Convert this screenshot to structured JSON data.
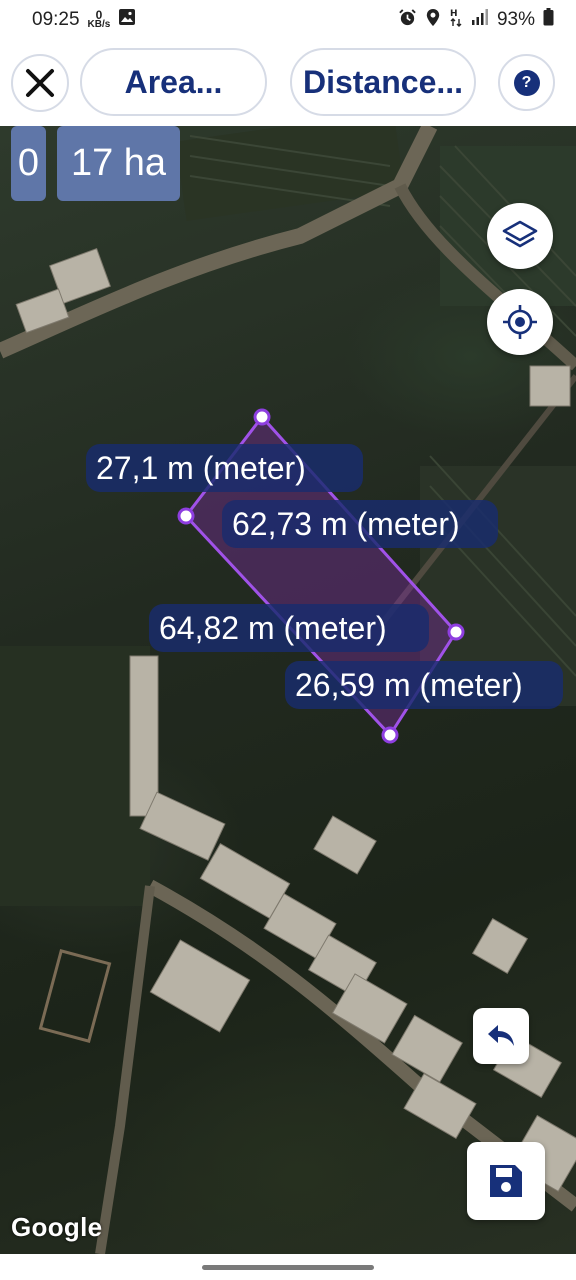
{
  "status_bar": {
    "time": "09:25",
    "net_speed_value": "0",
    "net_speed_unit": "KB/s",
    "battery": "93%",
    "icons": [
      "gallery-icon",
      "alarm-icon",
      "location-icon",
      "data-icon",
      "signal-icon",
      "battery-icon"
    ]
  },
  "toolbar": {
    "area_label": "Area...",
    "distance_label": "Distance...",
    "help_label": "?",
    "icons": {
      "close": "close-icon",
      "help": "help-icon"
    }
  },
  "map": {
    "chip_left": "0",
    "area_value": "17 ha",
    "labels": {
      "top_left": "27,1 m (meter)",
      "top_right": "62,73 m (meter)",
      "bottom_left": "64,82 m (meter)",
      "bottom_right": "26,59 m (meter)"
    },
    "attribution": "Google",
    "colors": {
      "polygon_stroke": "#a052e8",
      "polygon_fill": "#7a2c9e",
      "label_bg": "#182c6e",
      "chip_bg": "#5f76a8",
      "accent": "#17307a"
    },
    "fab_icons": [
      "layers-icon",
      "my-location-icon",
      "undo-icon",
      "save-icon"
    ]
  }
}
